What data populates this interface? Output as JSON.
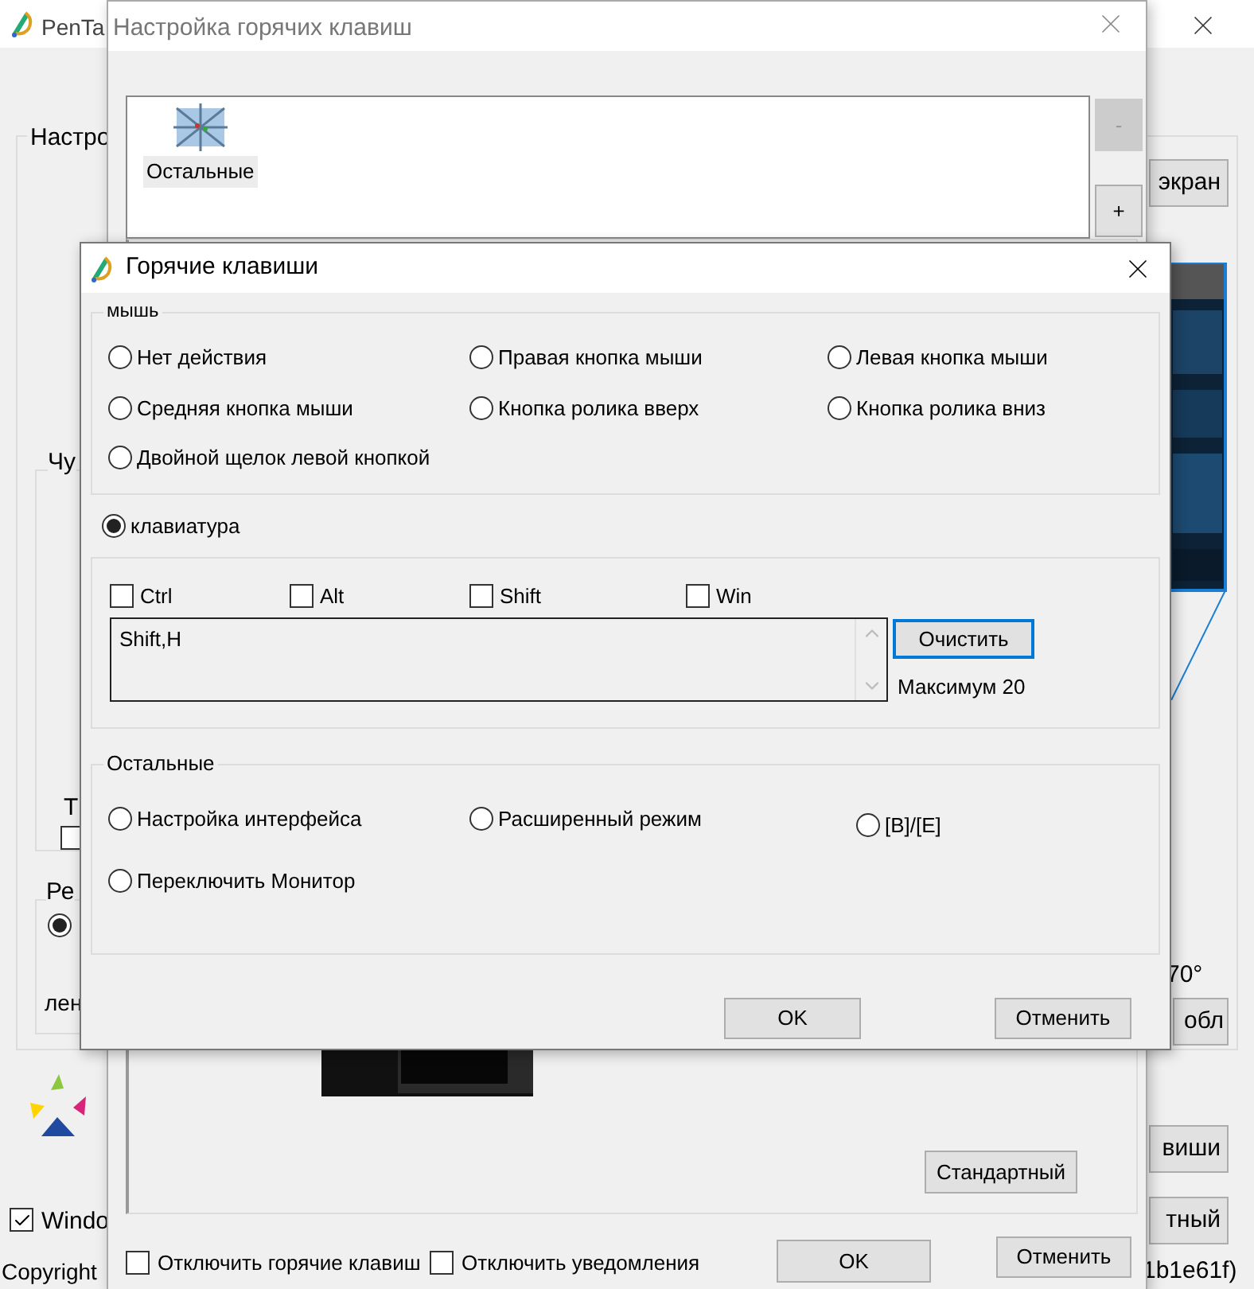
{
  "main_window": {
    "title": "PenTa",
    "group_label": "Настро",
    "subgroup_label": "Чу",
    "t_label": "Т",
    "t_checkbox": {
      "checked": false
    },
    "mode_label": "Ре",
    "mode_radio": {
      "selected": true
    },
    "mode_text": "лен",
    "screen_button": "экран",
    "angle_text": "70°",
    "area_button": "обл",
    "hotkeys_button": "виши",
    "default_button": "тный",
    "windows_checkbox": {
      "label": "Windo",
      "checked": true
    },
    "copyright": "Copyright",
    "version": "1b1e61f)"
  },
  "hotkey_settings_window": {
    "title": "Настройка горячих клавиш",
    "list_items": [
      {
        "label": "Остальные",
        "selected": true
      }
    ],
    "remove_button": {
      "label": "-",
      "disabled": true
    },
    "add_button": {
      "label": "+",
      "disabled": false
    },
    "standard_button": "Стандартный",
    "checkboxes": [
      {
        "label": "Отключить горячие клавиш",
        "checked": false
      },
      {
        "label": "Отключить уведомления",
        "checked": false
      }
    ],
    "ok_button": "OK",
    "cancel_button": "Отменить"
  },
  "hotkeys_dialog": {
    "title": "Горячие клавиши",
    "mouse_group": {
      "label": "мышь",
      "options": [
        {
          "label": "Нет действия",
          "selected": false
        },
        {
          "label": "Правая кнопка мыши",
          "selected": false
        },
        {
          "label": "Левая кнопка мыши",
          "selected": false
        },
        {
          "label": "Средняя кнопка мыши",
          "selected": false
        },
        {
          "label": "Кнопка ролика вверх",
          "selected": false
        },
        {
          "label": "Кнопка ролика вниз",
          "selected": false
        },
        {
          "label": "Двойной щелок левой кнопкой",
          "selected": false
        }
      ]
    },
    "keyboard_option": {
      "label": "клавиатура",
      "selected": true
    },
    "modifiers": [
      {
        "label": "Ctrl",
        "checked": false
      },
      {
        "label": "Alt",
        "checked": false
      },
      {
        "label": "Shift",
        "checked": false
      },
      {
        "label": "Win",
        "checked": false
      }
    ],
    "key_field": {
      "value": "Shift,H"
    },
    "clear_button": "Очистить",
    "max_note": "Максимум 20",
    "other_group": {
      "label": "Остальные",
      "options": [
        {
          "label": "Настройка интерфейса",
          "selected": false
        },
        {
          "label": "Расширенный режим",
          "selected": false
        },
        {
          "label": "[B]/[E]",
          "selected": false
        },
        {
          "label": "Переключить Монитор",
          "selected": false
        }
      ]
    },
    "ok_button": "OK",
    "cancel_button": "Отменить"
  }
}
